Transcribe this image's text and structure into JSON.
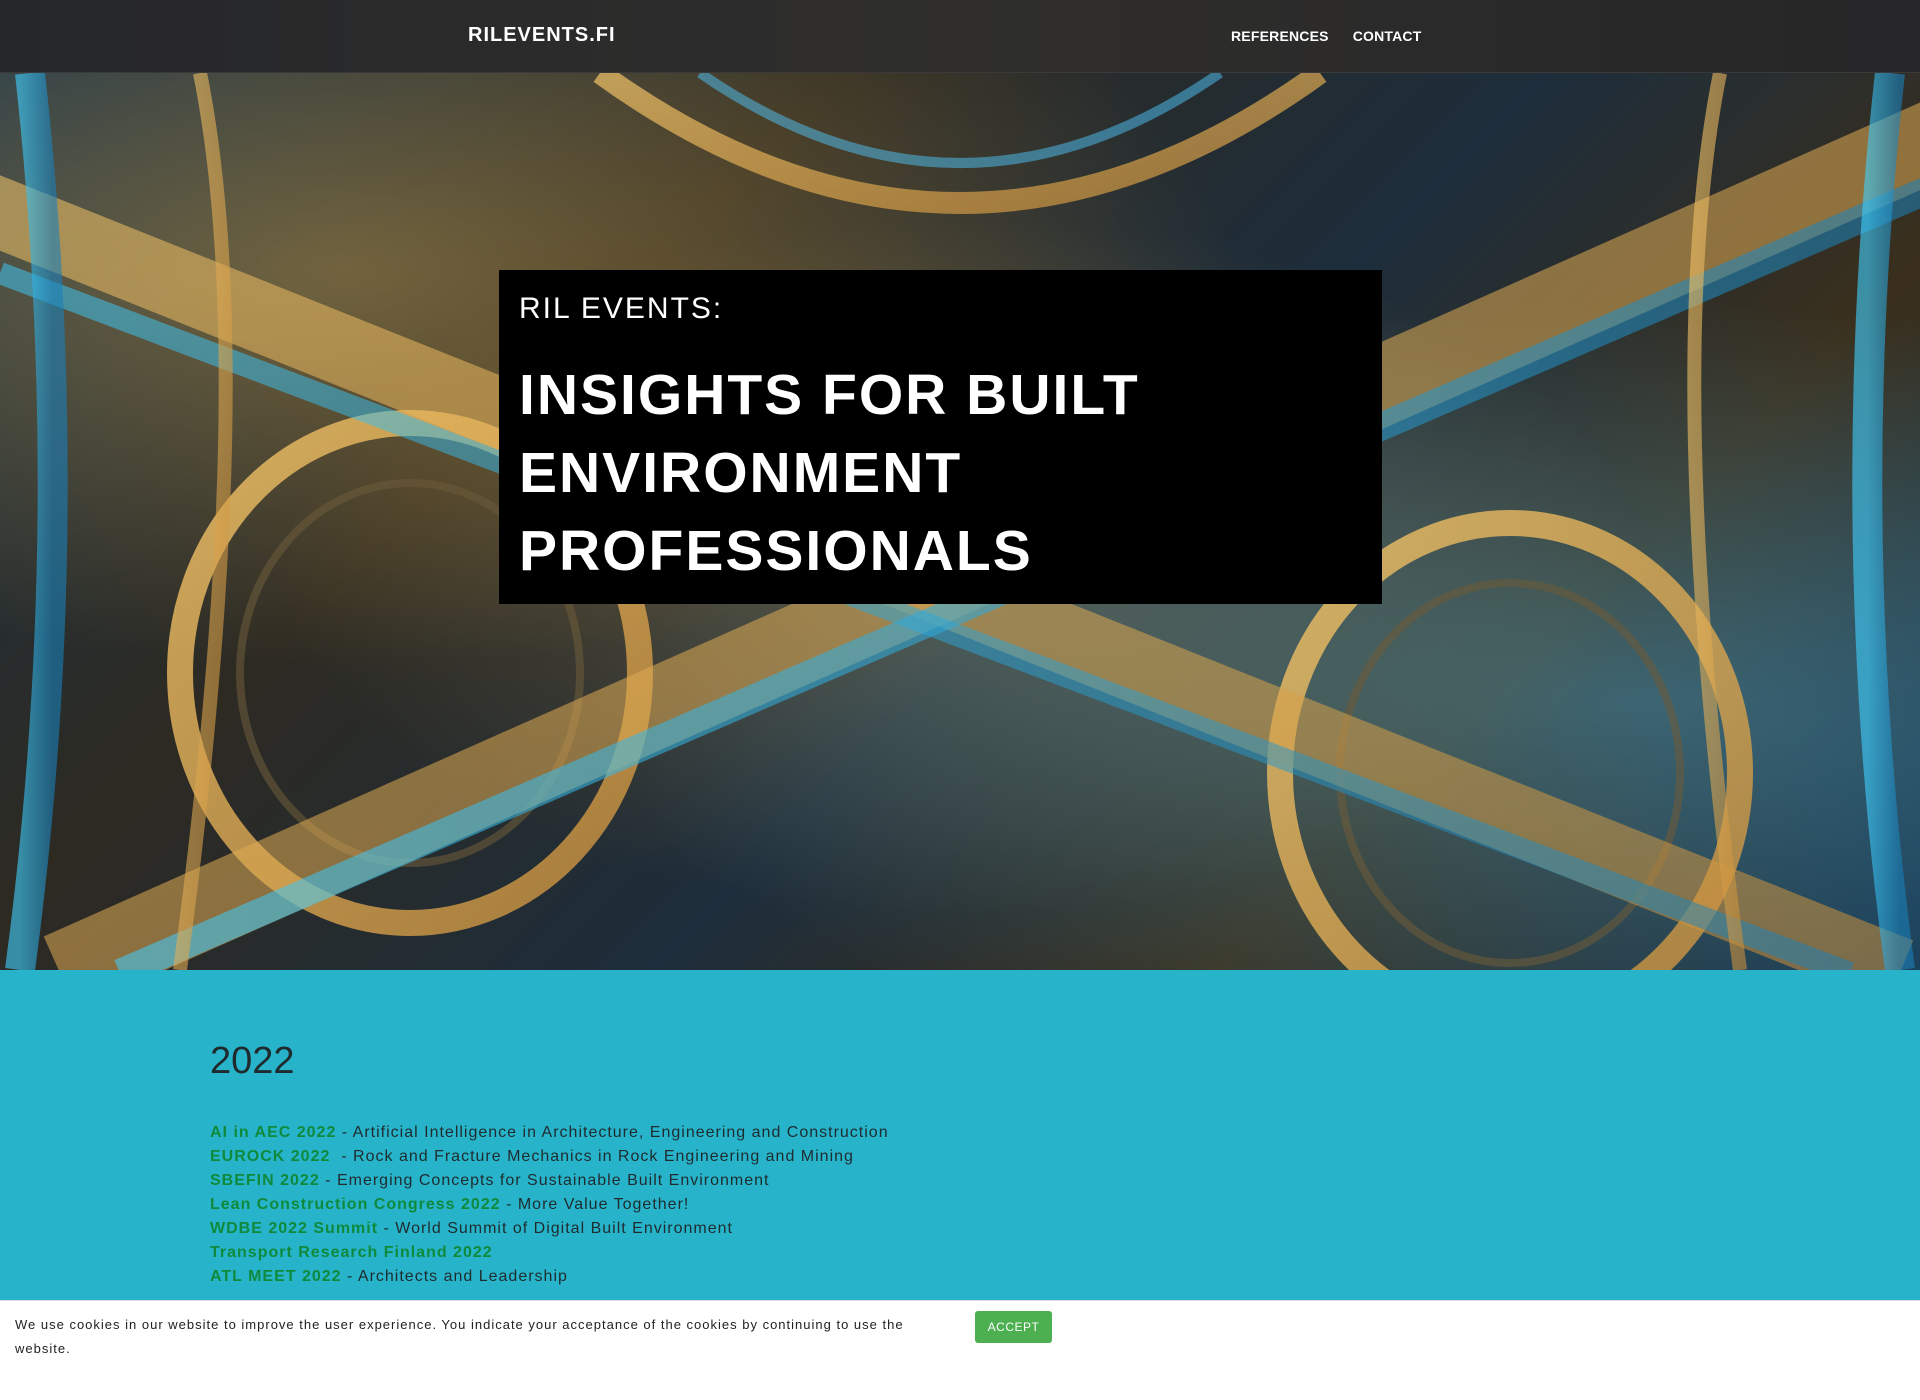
{
  "header": {
    "brand": "RILEVENTS.FI",
    "nav": [
      {
        "label": "REFERENCES"
      },
      {
        "label": "CONTACT"
      }
    ]
  },
  "hero": {
    "kicker": "RIL EVENTS:",
    "title_lines": [
      "INSIGHTS FOR BUILT",
      "ENVIRONMENT",
      "PROFESSIONALS"
    ]
  },
  "content": {
    "year": "2022",
    "events": [
      {
        "name": "AI in AEC 2022",
        "description": " - Artificial Intelligence in Architecture, Engineering and Construction"
      },
      {
        "name": "EUROCK 2022",
        "description": "  - Rock and Fracture Mechanics in Rock Engineering and Mining"
      },
      {
        "name": "SBEFIN 2022",
        "description": " - Emerging Concepts for Sustainable Built Environment"
      },
      {
        "name": "Lean Construction Congress 2022",
        "description": " - More Value Together!"
      },
      {
        "name": "WDBE 2022 Summit",
        "description": " - World Summit of Digital Built Environment"
      },
      {
        "name": "Transport Research Finland 2022",
        "description": ""
      },
      {
        "name": "ATL MEET 2022",
        "description": " - Architects and Leadership"
      }
    ]
  },
  "cookie": {
    "text": "We use cookies in our website to improve the user experience. You indicate your acceptance of the cookies by continuing to use the website.",
    "accept_label": "ACCEPT"
  },
  "colors": {
    "content_bg": "#27b4cb",
    "link_green": "#0f8a3c",
    "accept_green": "#4caf50",
    "header_bg": "#2b2b2b"
  }
}
